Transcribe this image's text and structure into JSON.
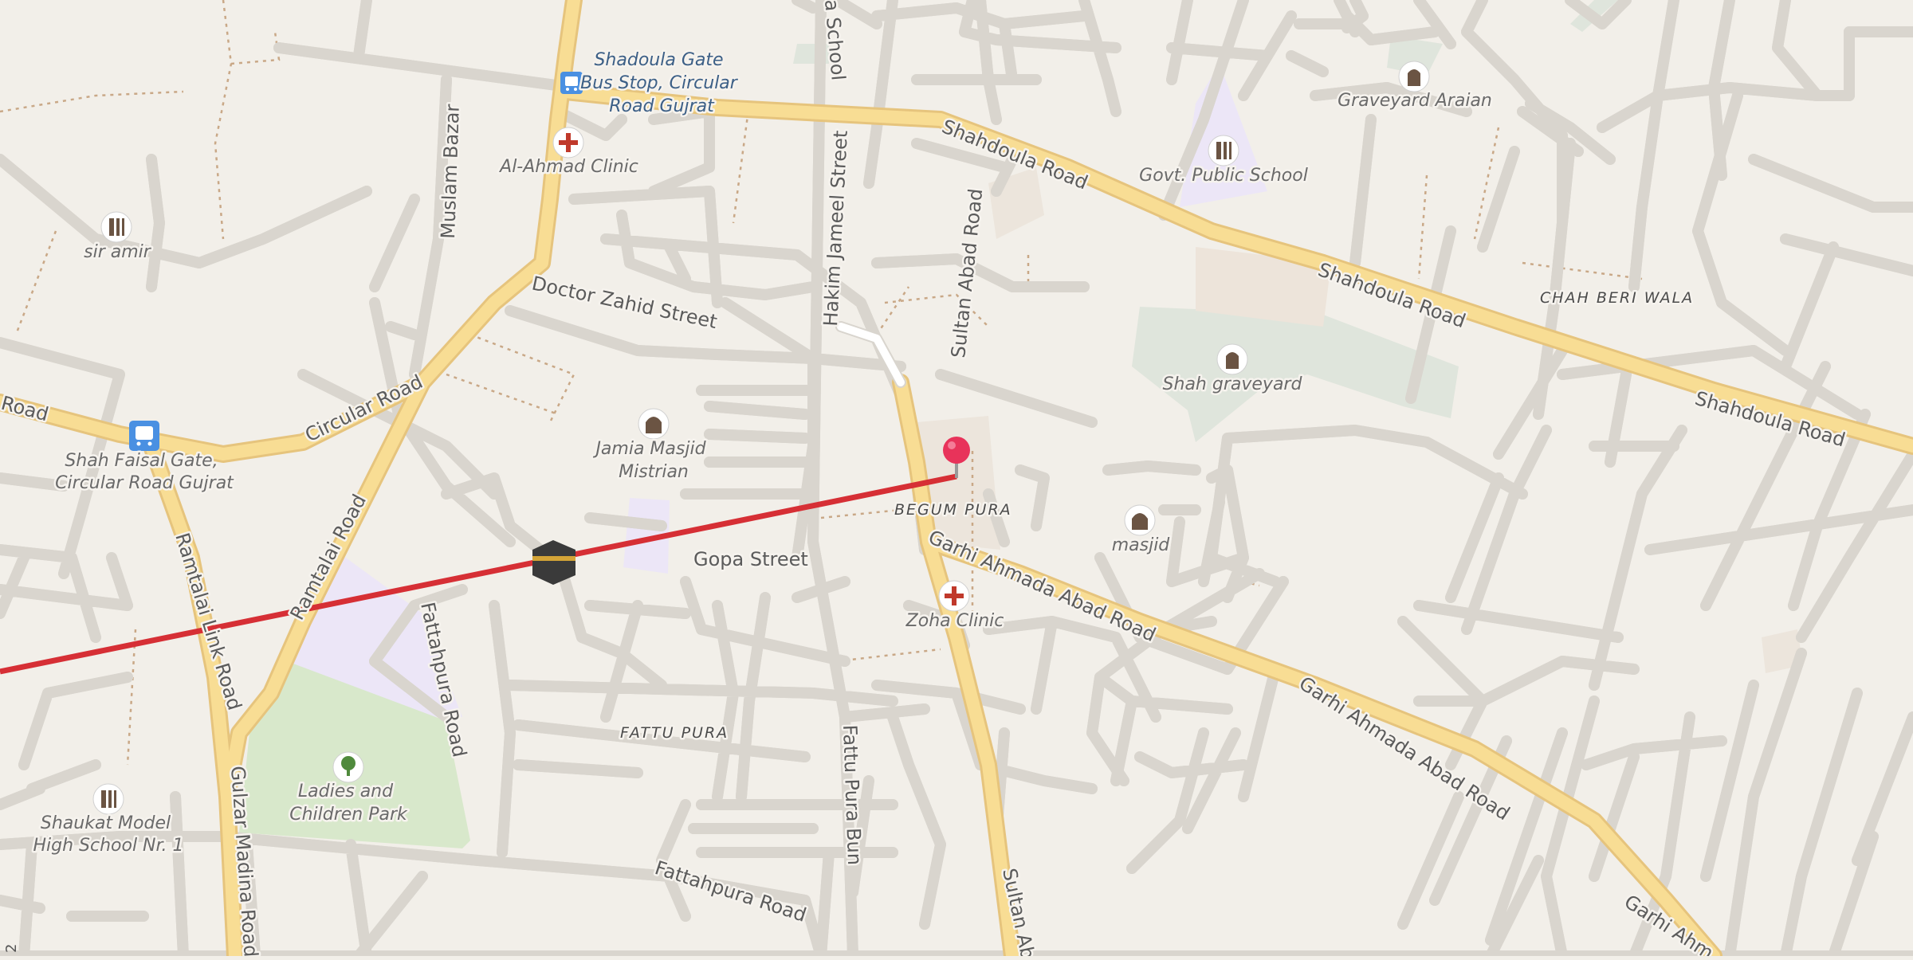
{
  "map": {
    "accent_route_color": "#d62f35",
    "marker_color": "#e8335a",
    "roads": {
      "shahdoula_road_1": "Shahdoula Road",
      "shahdoula_road_2": "Shahdoula Road",
      "shahdoula_road_3": "Shahdoula Road",
      "circular_road": "Circular Road",
      "road_left": "Road",
      "ramtalai_road": "Ramtalai Road",
      "ramtalai_link_road": "Ramtalai Link Road",
      "gulzar_madina_road": "Gulzar Madina Road",
      "muslam_bazar": "Muslam Bazar",
      "hakim_jameel_street": "Hakim Jameel Street",
      "school_road": "a School",
      "doctor_zahid_street": "Doctor Zahid Street",
      "sultan_abad_road_1": "Sultan Abad Road",
      "sultan_abad_road_2": "Sultan Ab",
      "gopa_street": "Gopa Street",
      "fattahpura_road_1": "Fattahpura Road",
      "fattahpura_road_2": "Fattahpura Road",
      "fattu_pura_bun": "Fattu Pura Bun",
      "garhi_ahmada_abad_road_1": "Garhi Ahmada Abad Road",
      "garhi_ahmada_abad_road_2": "Garhi Ahmada Abad Road",
      "garhi_ahmada_abad_road_3": "Garhi Ahm"
    },
    "places": {
      "begum_pura": "BEGUM PURA",
      "fattu_pura": "FATTU PURA",
      "chah_beri_wala": "CHAH BERI WALA"
    },
    "pois": {
      "shadoula_bus_stop": [
        "Shadoula Gate",
        "Bus Stop, Circular",
        "Road Gujrat"
      ],
      "al_ahmad_clinic": "Al-Ahmad Clinic",
      "sir_amir": "sir amir",
      "shah_faisal_gate": [
        "Shah Faisal Gate,",
        "Circular Road Gujrat"
      ],
      "jamia_masjid": [
        "Jamia Masjid",
        "Mistrian"
      ],
      "graveyard_araian": "Graveyard Araian",
      "govt_public_school": "Govt. Public School",
      "shah_graveyard": "Shah graveyard",
      "masjid": "masjid",
      "zoha_clinic": "Zoha Clinic",
      "ladies_park": [
        "Ladies and",
        "Children Park"
      ],
      "shaukat_school": [
        "Shaukat Model",
        "High School Nr. 1"
      ]
    },
    "edge_number": "2"
  }
}
